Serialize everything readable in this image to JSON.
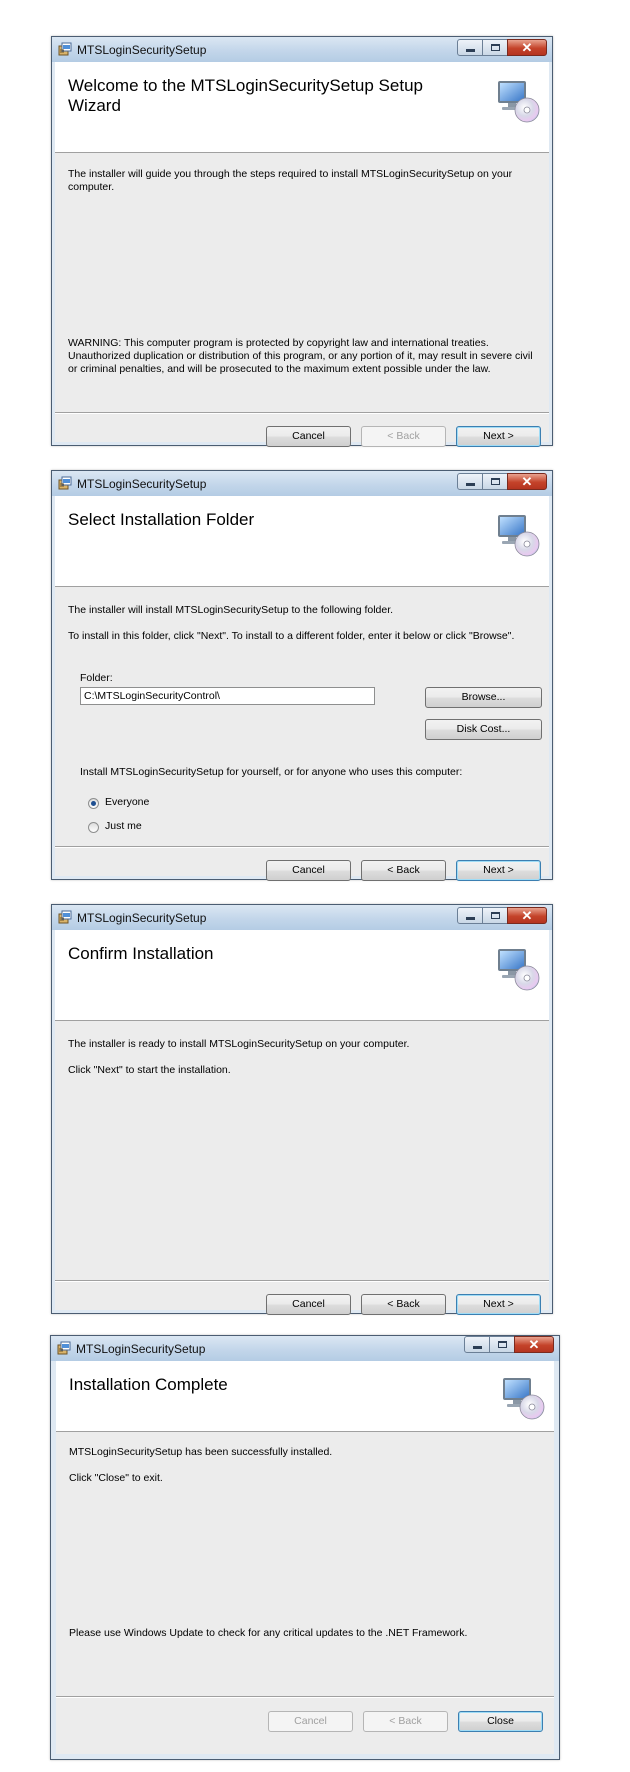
{
  "app_title": "MTSLoginSecuritySetup",
  "buttons": {
    "cancel": "Cancel",
    "back": "< Back",
    "next": "Next >",
    "close": "Close",
    "browse": "Browse...",
    "disk_cost": "Disk Cost..."
  },
  "icons": {
    "app": "installer-box-icon",
    "banner": "computer-with-disc-icon",
    "minimize": "minimize-icon",
    "maximize": "maximize-icon",
    "close": "close-icon"
  },
  "screen1": {
    "heading": "Welcome to the MTSLoginSecuritySetup Setup Wizard",
    "intro": "The installer will guide you through the steps required to install MTSLoginSecuritySetup on your computer.",
    "warning": "WARNING: This computer program is protected by copyright law and international treaties. Unauthorized duplication or distribution of this program, or any portion of it, may result in severe civil or criminal penalties, and will be prosecuted to the maximum extent possible under the law."
  },
  "screen2": {
    "heading": "Select Installation Folder",
    "line1": "The installer will install MTSLoginSecuritySetup to the following folder.",
    "line2": "To install in this folder, click \"Next\". To install to a different folder, enter it below or click \"Browse\".",
    "folder_label": "Folder:",
    "folder_value": "C:\\MTSLoginSecurityControl\\",
    "who_prompt": "Install MTSLoginSecuritySetup for yourself, or for anyone who uses this computer:",
    "option_everyone": "Everyone",
    "option_just_me": "Just me",
    "selected_option": "Everyone"
  },
  "screen3": {
    "heading": "Confirm Installation",
    "line1": "The installer is ready to install MTSLoginSecuritySetup on your computer.",
    "line2": "Click \"Next\" to start the installation."
  },
  "screen4": {
    "heading": "Installation Complete",
    "line1": "MTSLoginSecuritySetup has been successfully installed.",
    "line2": "Click \"Close\" to exit.",
    "update_note": "Please use Windows Update to check for any critical updates to the .NET Framework."
  }
}
